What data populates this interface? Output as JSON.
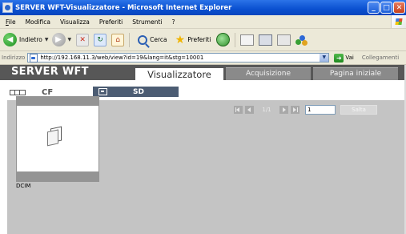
{
  "window": {
    "title": "SERVER WFT-Visualizzatore - Microsoft Internet Explorer",
    "buttons": {
      "minimize": "_",
      "maximize": "□",
      "close": "✕"
    }
  },
  "menu": {
    "items": [
      "File",
      "Modifica",
      "Visualizza",
      "Preferiti",
      "Strumenti",
      "?"
    ]
  },
  "toolbar": {
    "back_label": "Indietro",
    "search_label": "Cerca",
    "favorites_label": "Preferiti"
  },
  "address": {
    "label": "Indirizzo",
    "url": "http://192.168.11.3/web/view?id=19&lang=it&stg=10001",
    "go_label": "Vai",
    "links_label": "Collegamenti"
  },
  "page": {
    "brand": "SERVER WFT",
    "nav": {
      "active": "Visualizzatore",
      "acquisition": "Acquisizione",
      "home": "Pagina iniziale"
    },
    "cards": {
      "cf_label": "CF",
      "sd_label": "SD"
    },
    "pager": {
      "count": "1/1",
      "page_value": "1",
      "go_label": "Salta"
    },
    "items": [
      {
        "name": "DCIM"
      }
    ]
  },
  "colors": {
    "header_bg": "#575757",
    "sd_tab": "#4c5c73",
    "gray_area": "#c4c4c4"
  }
}
